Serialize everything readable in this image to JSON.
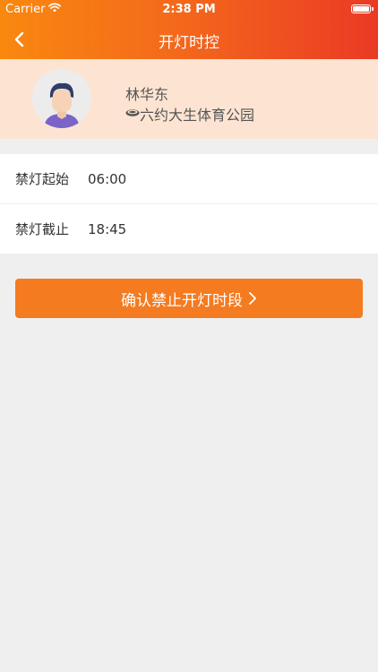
{
  "status_bar": {
    "carrier": "Carrier",
    "time": "2:38 PM"
  },
  "nav": {
    "title": "开灯时控"
  },
  "user": {
    "name": "林华东",
    "location": "六约大生体育公园"
  },
  "schedule": {
    "rows": [
      {
        "label": "禁灯起始",
        "value": "06:00"
      },
      {
        "label": "禁灯截止",
        "value": "18:45"
      }
    ]
  },
  "action": {
    "confirm_label": "确认禁止开灯时段"
  },
  "colors": {
    "header_start": "#f9880f",
    "header_end": "#ea3a25",
    "profile_bg": "#fde4d2",
    "button_bg": "#f47b20",
    "page_bg": "#efefef"
  },
  "icons": {
    "back": "chevron-left-icon",
    "wifi": "wifi-icon",
    "battery": "battery-icon",
    "location": "lamp-icon",
    "forward": "chevron-right-icon"
  }
}
